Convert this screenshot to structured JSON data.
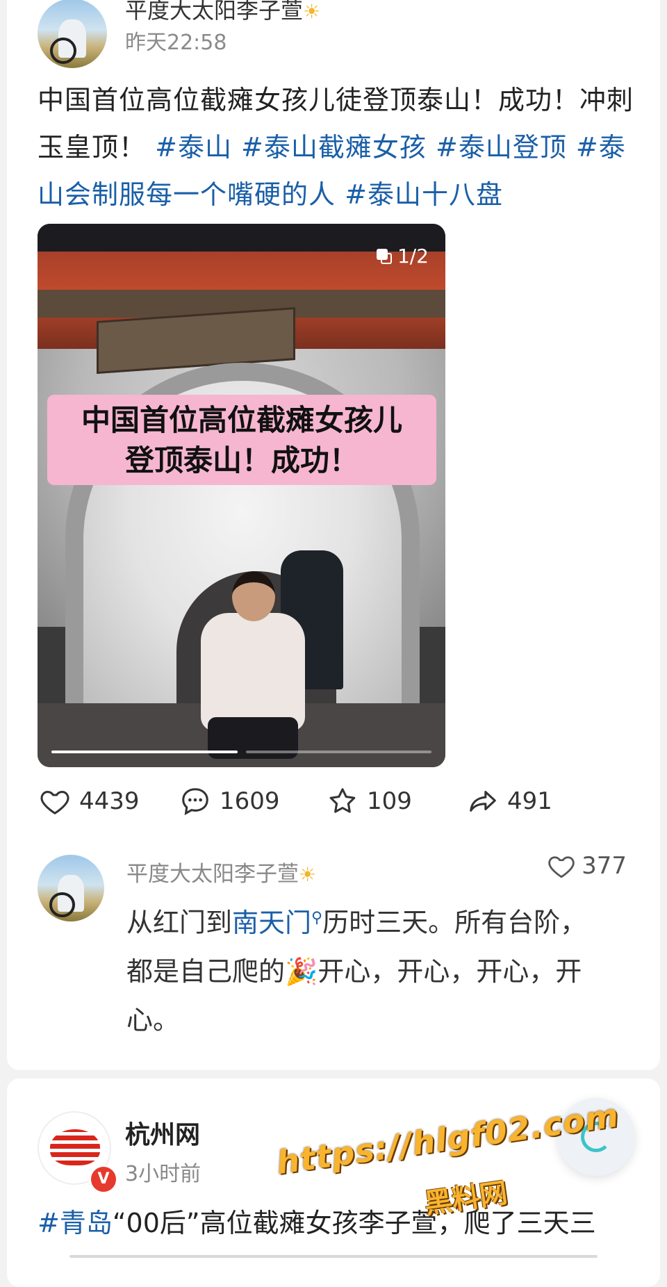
{
  "post1": {
    "author": "平度大太阳李子萱",
    "time": "昨天22:58",
    "text_prefix": "中国首位高位截瘫女孩儿徒登顶泰山！成功！冲刺玉皇顶！",
    "hashtags": [
      "#泰山",
      "#泰山截瘫女孩",
      "#泰山登顶",
      "#泰山会制服每一个嘴硬的人",
      "#泰山十八盘"
    ],
    "image": {
      "counter": "1/2",
      "caption_line1": "中国首位高位截瘫女孩儿",
      "caption_line2": "登顶泰山！成功！",
      "slide_index": 1,
      "slide_total": 2
    },
    "actions": {
      "likes": "4439",
      "comments": "1609",
      "favorites": "109",
      "shares": "491"
    }
  },
  "comment": {
    "author": "平度大太阳李子萱",
    "likes": "377",
    "text_before_link": "从红门到",
    "link_text": "南天门",
    "text_mid": "历时三天。所有台阶，都是自己爬的",
    "text_after": "开心，开心，开心，开心。"
  },
  "post2": {
    "author": "杭州网",
    "time": "3小时前",
    "hashtag": "#青岛",
    "text": "“00后”高位截瘫女孩李子萱，爬了三天三"
  },
  "watermark": {
    "url": "https://hlgf02.com",
    "site": "黑料网"
  },
  "colors": {
    "link_blue": "#1a5fa8",
    "caption_pink": "#f6b6d0",
    "verified_red": "#e63a2e",
    "watermark_orange": "#f8b42f"
  }
}
